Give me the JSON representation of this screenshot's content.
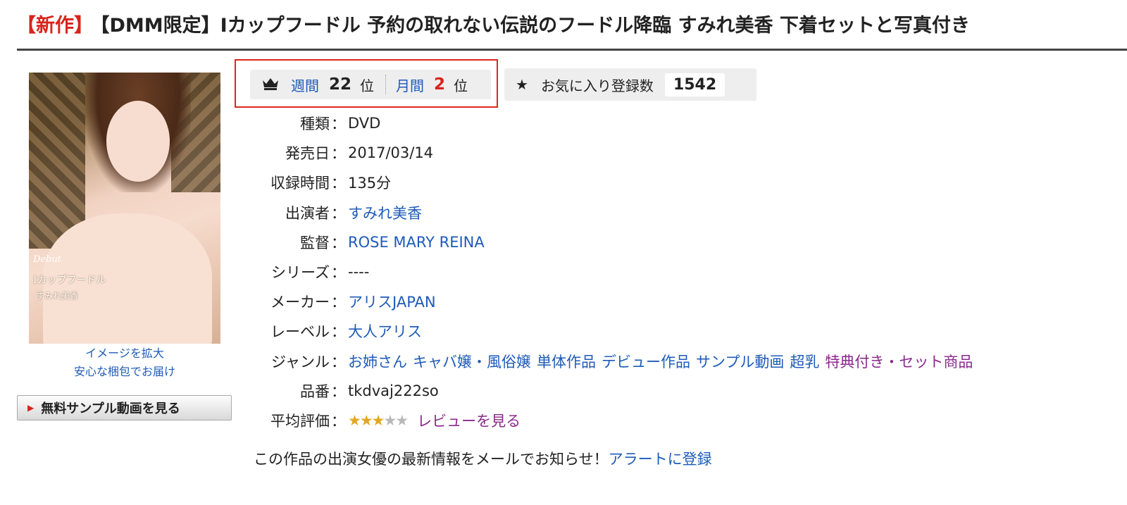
{
  "header": {
    "new_tag": "【新作】",
    "title": "【DMM限定】Iカップフードル 予約の取れない伝説のフードル降臨 すみれ美香 下着セットと写真付き"
  },
  "cover": {
    "art_debut": "Debut",
    "art_title": "Iカップフードル",
    "art_name": "すみれ美香",
    "enlarge_link": "イメージを拡大",
    "packaging_link": "安心な梱包でお届け"
  },
  "sample_button": {
    "label": "無料サンプル動画を見る"
  },
  "ranking": {
    "weekly_label": "週間",
    "weekly_rank": "22",
    "monthly_label": "月間",
    "monthly_rank": "2",
    "unit": "位"
  },
  "favorites": {
    "label": "お気に入り登録数",
    "count": "1542"
  },
  "details": {
    "separator": "：",
    "type": {
      "key": "種類",
      "value": "DVD"
    },
    "release_date": {
      "key": "発売日",
      "value": "2017/03/14"
    },
    "duration": {
      "key": "収録時間",
      "value": "135分"
    },
    "cast": {
      "key": "出演者",
      "value": "すみれ美香"
    },
    "director": {
      "key": "監督",
      "value": "ROSE MARY REINA"
    },
    "series": {
      "key": "シリーズ",
      "value": "----"
    },
    "maker": {
      "key": "メーカー",
      "value": "アリスJAPAN"
    },
    "label": {
      "key": "レーベル",
      "value": "大人アリス"
    },
    "genre": {
      "key": "ジャンル",
      "items": [
        "お姉さん",
        "キャバ嬢・風俗嬢",
        "単体作品",
        "デビュー作品",
        "サンプル動画",
        "超乳",
        "特典付き・セット商品"
      ]
    },
    "product_code": {
      "key": "品番",
      "value": "tkdvaj222so"
    },
    "rating": {
      "key": "平均評価",
      "stars": 2.5,
      "max": 5,
      "review_link": "レビューを見る"
    }
  },
  "alert": {
    "text": "この作品の出演女優の最新情報をメールでお知らせ！",
    "link": "アラートに登録"
  }
}
